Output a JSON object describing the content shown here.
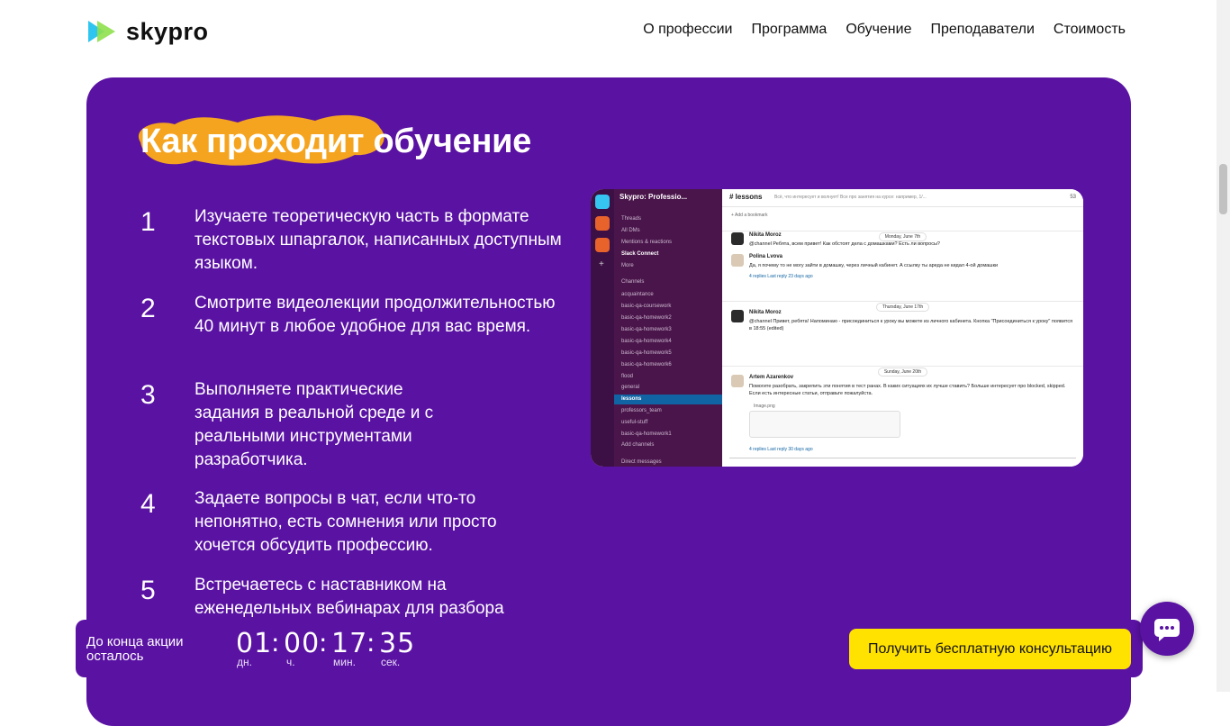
{
  "header": {
    "logo_text": "skypro",
    "nav": [
      "О профессии",
      "Программа",
      "Обучение",
      "Преподаватели",
      "Стоимость"
    ]
  },
  "section": {
    "title": "Как проходит обучение",
    "steps": [
      {
        "num": "1",
        "text": "Изучаете теоретическую часть в формате текстовых шпаргалок, написанных доступным языком."
      },
      {
        "num": "2",
        "text": "Смотрите видеолекции продолжительностью 40 минут в любое удобное для вас время."
      },
      {
        "num": "3",
        "text": "Выполняете практические задания в реальной среде и с реальными инструментами разработчика."
      },
      {
        "num": "4",
        "text": "Задаете вопросы в чат, если что-то непонятно, есть сомнения или просто хочется обсудить профессию."
      },
      {
        "num": "5",
        "text": "Встречаетесь с наставником на еженедельных вебинарах для разбора"
      }
    ]
  },
  "screenshot": {
    "workspace": "Skypro: Professio...",
    "sidebar_items": [
      "Threads",
      "All DMs",
      "Mentions & reactions",
      "Slack Connect",
      "More",
      "Channels",
      "acquaintance",
      "basic-qa-coursework",
      "basic-qa-homework2",
      "basic-qa-homework3",
      "basic-qa-homework4",
      "basic-qa-homework5",
      "basic-qa-homework6",
      "flood",
      "general",
      "lessons",
      "professors_team",
      "useful-stuff",
      "basic-qa-homework1",
      "Add channels",
      "Direct messages"
    ],
    "channel": "# lessons",
    "topic": "Всё, что интересует и волнует! Все про занятия на курсе: например, 1/...",
    "bookmark": "+ Add a bookmark",
    "member_count": "53",
    "messages": [
      {
        "date": "Monday, June 7th",
        "author": "Nikita Moroz",
        "time": "4:33 PM",
        "text": "@channel Ребята, всем привет! Как обстоят дела с домашками? Есть ли вопросы?",
        "replies": ""
      },
      {
        "date": "",
        "author": "Polina Lvova",
        "time": "5:16 PM",
        "text": "Да, я почему то не могу зайти в домашку, через личный кабинет. А ссылку ты аредa не кидал 4-ой домашки",
        "replies": "4 replies  Last reply 23 days ago"
      },
      {
        "date": "Thursday, June 17th",
        "author": "Nikita Moroz",
        "time": "4:47 PM",
        "text": "@channel Привет, ребята! Напоминаю - присоединиться к уроку вы можете из личного кабинета. Кнопка \"Присоединиться к уроку\" появится в 18:55 (edited)",
        "replies": ""
      },
      {
        "date": "Sunday, June 20th",
        "author": "Artem Azarenkov",
        "time": "1:13 PM",
        "text": "Помогите разобрать, закрепить эти понятия в тест ранах. В каких ситуациях их лучше ставить? Больше интересует про blocked, skipped. Если есть интересные статьи, отправьте пожалуйста.",
        "replies": "4 replies  Last reply 30 days ago"
      }
    ],
    "attachment": "Image.png"
  },
  "timer": {
    "label": "До конца акции осталось",
    "days": "01",
    "hours": "00",
    "minutes": "17",
    "seconds": "35",
    "units": [
      "дн.",
      "ч.",
      "мин.",
      "сек."
    ]
  },
  "cta_label": "Получить бесплатную консультацию",
  "colors": {
    "purple": "#5a12a3",
    "yellow": "#ffe200",
    "blob": "#f5a41f"
  }
}
